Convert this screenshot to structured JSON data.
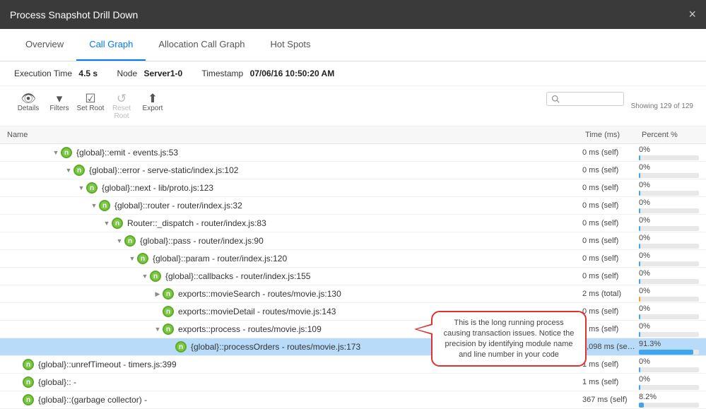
{
  "title": "Process Snapshot Drill Down",
  "tabs": [
    "Overview",
    "Call Graph",
    "Allocation Call Graph",
    "Hot Spots"
  ],
  "activeTab": 1,
  "meta": {
    "execLabel": "Execution Time",
    "execVal": "4.5 s",
    "nodeLabel": "Node",
    "nodeVal": "Server1-0",
    "tsLabel": "Timestamp",
    "tsVal": "07/06/16 10:50:20 AM"
  },
  "toolbar": {
    "details": "Details",
    "filters": "Filters",
    "setroot": "Set Root",
    "resetroot": "Reset Root",
    "export": "Export",
    "showing": "Showing 129 of 129"
  },
  "columns": {
    "name": "Name",
    "time": "Time (ms)",
    "pct": "Percent %"
  },
  "rows": [
    {
      "indent": 4,
      "exp": "down",
      "label": "{global}::emit - events.js:53",
      "time": "0 ms (self)",
      "pct": "0%",
      "bar": 2
    },
    {
      "indent": 5,
      "exp": "down",
      "label": "{global}::error - serve-static/index.js:102",
      "time": "0 ms (self)",
      "pct": "0%",
      "bar": 2
    },
    {
      "indent": 6,
      "exp": "down",
      "label": "{global}::next - lib/proto.js:123",
      "time": "0 ms (self)",
      "pct": "0%",
      "bar": 2
    },
    {
      "indent": 7,
      "exp": "down",
      "label": "{global}::router - router/index.js:32",
      "time": "0 ms (self)",
      "pct": "0%",
      "bar": 2
    },
    {
      "indent": 8,
      "exp": "down",
      "label": "Router::_dispatch - router/index.js:83",
      "time": "0 ms (self)",
      "pct": "0%",
      "bar": 2
    },
    {
      "indent": 9,
      "exp": "down",
      "label": "{global}::pass - router/index.js:90",
      "time": "0 ms (self)",
      "pct": "0%",
      "bar": 2
    },
    {
      "indent": 10,
      "exp": "down",
      "label": "{global}::param - router/index.js:120",
      "time": "0 ms (self)",
      "pct": "0%",
      "bar": 2
    },
    {
      "indent": 11,
      "exp": "down",
      "label": "{global}::callbacks - router/index.js:155",
      "time": "0 ms (self)",
      "pct": "0%",
      "bar": 2
    },
    {
      "indent": 12,
      "exp": "right",
      "label": "exports::movieSearch - routes/movie.js:130",
      "time": "2 ms (total)",
      "pct": "0%",
      "bar": 2,
      "barColor": "#f0a030"
    },
    {
      "indent": 12,
      "exp": "",
      "label": "exports::movieDetail - routes/movie.js:143",
      "time": "0 ms (self)",
      "pct": "0%",
      "bar": 2
    },
    {
      "indent": 12,
      "exp": "down",
      "label": "exports::process - routes/movie.js:109",
      "time": "1 ms (self)",
      "pct": "0%",
      "bar": 2
    },
    {
      "indent": 13,
      "exp": "",
      "label": "{global}::processOrders - routes/movie.js:173",
      "time": "4,098 ms (se…",
      "pct": "91.3%",
      "bar": 91,
      "sel": true
    },
    {
      "indent": 1,
      "exp": "",
      "label": "{global}::unrefTimeout - timers.js:399",
      "time": "1 ms (self)",
      "pct": "0%",
      "bar": 2
    },
    {
      "indent": 1,
      "exp": "",
      "label": "{global}:: -",
      "time": "1 ms (self)",
      "pct": "0%",
      "bar": 2
    },
    {
      "indent": 1,
      "exp": "",
      "label": "{global}::(garbage collector) -",
      "time": "367 ms (self)",
      "pct": "8.2%",
      "bar": 8
    }
  ],
  "callout": "This is the long running process causing transaction issues. Notice the precision by identifying module name and line number in your code"
}
